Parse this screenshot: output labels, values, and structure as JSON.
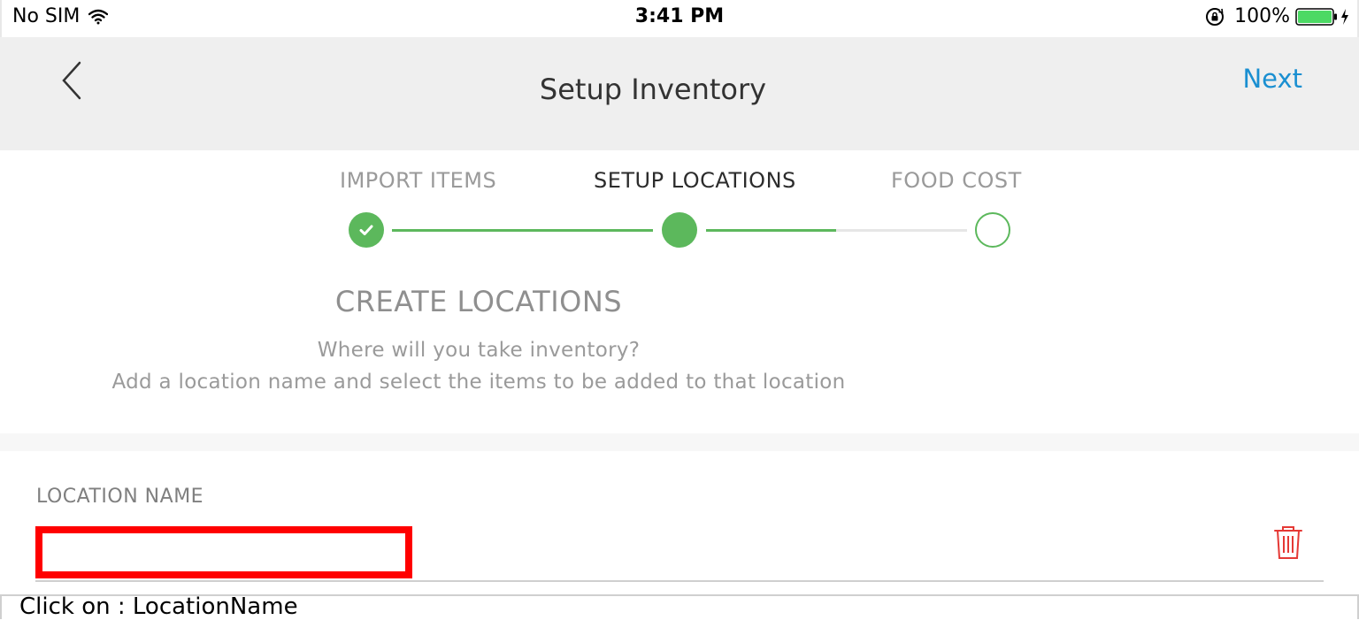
{
  "status_bar": {
    "carrier": "No SIM",
    "time": "3:41 PM",
    "battery": "100%",
    "icons": [
      "wifi-icon",
      "orientation-lock-icon",
      "battery-icon",
      "charging-icon"
    ]
  },
  "nav": {
    "title": "Setup Inventory",
    "next_label": "Next",
    "back_icon": "chevron-left-icon",
    "accent_color": "#1a8fd1"
  },
  "stepper": {
    "steps": [
      {
        "label": "IMPORT ITEMS",
        "state": "completed"
      },
      {
        "label": "SETUP LOCATIONS",
        "state": "current"
      },
      {
        "label": "FOOD COST",
        "state": "pending"
      }
    ],
    "progress_color": "#5cb85c"
  },
  "section": {
    "title": "CREATE LOCATIONS",
    "subtitle_line1": "Where will you take inventory?",
    "subtitle_line2": "Add a location name and select the items to be added to that location"
  },
  "form": {
    "location_label": "LOCATION NAME",
    "location_value": "",
    "highlight_color": "#ff0000",
    "delete_icon": "trash-icon",
    "delete_color": "#e53935"
  },
  "caption": {
    "text": "Click on : LocationName"
  }
}
